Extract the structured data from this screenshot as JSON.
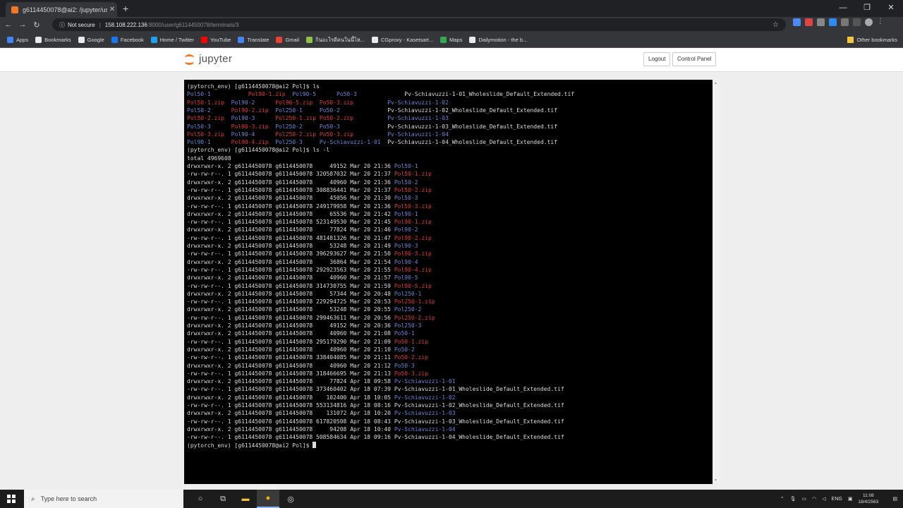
{
  "browser": {
    "tab_title": "g6114450078@ai2: /jupyter/user",
    "address_prefix": "Not secure",
    "address_host": "158.108.222.136",
    "address_path": ":8000/user/g6114450078/terminals/3",
    "window_controls": [
      "—",
      "❐",
      "✕"
    ]
  },
  "bookmarks": [
    {
      "label": "Apps",
      "color": "#4285f4"
    },
    {
      "label": "Bookmarks",
      "color": "#e8eaed"
    },
    {
      "label": "Google",
      "color": "#e8eaed"
    },
    {
      "label": "Facebook",
      "color": "#1877f2"
    },
    {
      "label": "Home / Twitter",
      "color": "#1da1f2"
    },
    {
      "label": "YouTube",
      "color": "#ff0000"
    },
    {
      "label": "Translate",
      "color": "#4285f4"
    },
    {
      "label": "Gmail",
      "color": "#ea4335"
    },
    {
      "label": "กินอะไรดีคนในนี้ไห...",
      "color": "#8bc34a"
    },
    {
      "label": "CGproxy - Kasetsart...",
      "color": "#e8eaed"
    },
    {
      "label": "Maps",
      "color": "#34a853"
    },
    {
      "label": "Dailymotion - the b...",
      "color": "#e8eaed"
    }
  ],
  "bookmarks_other": "Other bookmarks",
  "jupyter": {
    "logo_text": "jupyter",
    "logout_label": "Logout",
    "control_panel_label": "Control Panel"
  },
  "terminal": {
    "lines": [
      {
        "spans": [
          {
            "t": "(pytorch_env) [g6114450078@ai2 Pol]$ ls",
            "c": "white"
          }
        ]
      },
      {
        "spans": [
          {
            "t": "Pol50-1           ",
            "c": "blue"
          },
          {
            "t": "Pol90-1.zip  ",
            "c": "red"
          },
          {
            "t": "Pol90-5      ",
            "c": "blue"
          },
          {
            "t": "Po50-3              ",
            "c": "blue"
          },
          {
            "t": "Pv-Schiavuzzi-1-01_Wholeslide_Default_Extended.tif",
            "c": "white"
          }
        ]
      },
      {
        "spans": [
          {
            "t": "Pol50-1.zip  ",
            "c": "red"
          },
          {
            "t": "Pol90-2      ",
            "c": "blue"
          },
          {
            "t": "Pol90-5.zip  ",
            "c": "red"
          },
          {
            "t": "Po50-3.zip          ",
            "c": "red"
          },
          {
            "t": "Pv-Schiavuzzi-1-02",
            "c": "blue"
          }
        ]
      },
      {
        "spans": [
          {
            "t": "Pol50-2      ",
            "c": "blue"
          },
          {
            "t": "Pol90-2.zip  ",
            "c": "red"
          },
          {
            "t": "Pol250-1     ",
            "c": "blue"
          },
          {
            "t": "Po50-2              ",
            "c": "blue"
          },
          {
            "t": "Pv-Schiavuzzi-1-02_Wholeslide_Default_Extended.tif",
            "c": "white"
          }
        ]
      },
      {
        "spans": [
          {
            "t": "Pol50-2.zip  ",
            "c": "red"
          },
          {
            "t": "Pol90-3      ",
            "c": "blue"
          },
          {
            "t": "Pol250-1.zip ",
            "c": "red"
          },
          {
            "t": "Po50-2.zip          ",
            "c": "red"
          },
          {
            "t": "Pv-Schiavuzzi-1-03",
            "c": "blue"
          }
        ]
      },
      {
        "spans": [
          {
            "t": "Pol50-3      ",
            "c": "blue"
          },
          {
            "t": "Pol90-3.zip  ",
            "c": "red"
          },
          {
            "t": "Pol250-2     ",
            "c": "blue"
          },
          {
            "t": "Po50-3              ",
            "c": "blue"
          },
          {
            "t": "Pv-Schiavuzzi-1-03_Wholeslide_Default_Extended.tif",
            "c": "white"
          }
        ]
      },
      {
        "spans": [
          {
            "t": "Pol50-3.zip  ",
            "c": "red"
          },
          {
            "t": "Pol90-4      ",
            "c": "blue"
          },
          {
            "t": "Pol250-2.zip ",
            "c": "red"
          },
          {
            "t": "Po50-3.zip          ",
            "c": "red"
          },
          {
            "t": "Pv-Schiavuzzi-1-04",
            "c": "blue"
          }
        ]
      },
      {
        "spans": [
          {
            "t": "Pol90-1      ",
            "c": "blue"
          },
          {
            "t": "Pol90-4.zip  ",
            "c": "red"
          },
          {
            "t": "Pol250-3     ",
            "c": "blue"
          },
          {
            "t": "Pv-Schiavuzzi-1-01  ",
            "c": "blue"
          },
          {
            "t": "Pv-Schiavuzzi-1-04_Wholeslide_Default_Extended.tif",
            "c": "white"
          }
        ]
      },
      {
        "spans": [
          {
            "t": "(pytorch_env) [g6114450078@ai2 Pol]$ ls -l",
            "c": "white"
          }
        ]
      },
      {
        "spans": [
          {
            "t": "total 4969608",
            "c": "white"
          }
        ]
      },
      {
        "spans": [
          {
            "t": "drwxrwxr-x. 2 g6114450078 g6114450078     49152 Mar 20 21:36 ",
            "c": "white"
          },
          {
            "t": "Pol50-1",
            "c": "blue"
          }
        ]
      },
      {
        "spans": [
          {
            "t": "-rw-rw-r--. 1 g6114450078 g6114450078 320587032 Mar 20 21:37 ",
            "c": "white"
          },
          {
            "t": "Pol50-1.zip",
            "c": "red"
          }
        ]
      },
      {
        "spans": [
          {
            "t": "drwxrwxr-x. 2 g6114450078 g6114450078     40960 Mar 20 21:36 ",
            "c": "white"
          },
          {
            "t": "Pol50-2",
            "c": "blue"
          }
        ]
      },
      {
        "spans": [
          {
            "t": "-rw-rw-r--. 1 g6114450078 g6114450078 308836441 Mar 20 21:37 ",
            "c": "white"
          },
          {
            "t": "Pol50-2.zip",
            "c": "red"
          }
        ]
      },
      {
        "spans": [
          {
            "t": "drwxrwxr-x. 2 g6114450078 g6114450078     45056 Mar 20 21:30 ",
            "c": "white"
          },
          {
            "t": "Pol50-3",
            "c": "blue"
          }
        ]
      },
      {
        "spans": [
          {
            "t": "-rw-rw-r--. 1 g6114450078 g6114450078 249179958 Mar 20 21:36 ",
            "c": "white"
          },
          {
            "t": "Pol50-3.zip",
            "c": "red"
          }
        ]
      },
      {
        "spans": [
          {
            "t": "drwxrwxr-x. 2 g6114450078 g6114450078     65536 Mar 20 21:42 ",
            "c": "white"
          },
          {
            "t": "Pol90-1",
            "c": "blue"
          }
        ]
      },
      {
        "spans": [
          {
            "t": "-rw-rw-r--. 1 g6114450078 g6114450078 523149530 Mar 20 21:45 ",
            "c": "white"
          },
          {
            "t": "Pol90-1.zip",
            "c": "red"
          }
        ]
      },
      {
        "spans": [
          {
            "t": "drwxrwxr-x. 2 g6114450078 g6114450078     77824 Mar 20 21:46 ",
            "c": "white"
          },
          {
            "t": "Pol90-2",
            "c": "blue"
          }
        ]
      },
      {
        "spans": [
          {
            "t": "-rw-rw-r--. 1 g6114450078 g6114450078 481481326 Mar 20 21:47 ",
            "c": "white"
          },
          {
            "t": "Pol90-2.zip",
            "c": "red"
          }
        ]
      },
      {
        "spans": [
          {
            "t": "drwxrwxr-x. 2 g6114450078 g6114450078     53248 Mar 20 21:49 ",
            "c": "white"
          },
          {
            "t": "Pol90-3",
            "c": "blue"
          }
        ]
      },
      {
        "spans": [
          {
            "t": "-rw-rw-r--. 1 g6114450078 g6114450078 396293627 Mar 20 21:50 ",
            "c": "white"
          },
          {
            "t": "Pol90-3.zip",
            "c": "red"
          }
        ]
      },
      {
        "spans": [
          {
            "t": "drwxrwxr-x. 2 g6114450078 g6114450078     36864 Mar 20 21:54 ",
            "c": "white"
          },
          {
            "t": "Pol90-4",
            "c": "blue"
          }
        ]
      },
      {
        "spans": [
          {
            "t": "-rw-rw-r--. 1 g6114450078 g6114450078 292923563 Mar 20 21:55 ",
            "c": "white"
          },
          {
            "t": "Pol90-4.zip",
            "c": "red"
          }
        ]
      },
      {
        "spans": [
          {
            "t": "drwxrwxr-x. 2 g6114450078 g6114450078     40960 Mar 20 21:57 ",
            "c": "white"
          },
          {
            "t": "Pol90-5",
            "c": "blue"
          }
        ]
      },
      {
        "spans": [
          {
            "t": "-rw-rw-r--. 1 g6114450078 g6114450078 314730755 Mar 20 21:59 ",
            "c": "white"
          },
          {
            "t": "Pol90-5.zip",
            "c": "red"
          }
        ]
      },
      {
        "spans": [
          {
            "t": "drwxrwxr-x. 2 g6114450078 g6114450078     57344 Mar 20 20:48 ",
            "c": "white"
          },
          {
            "t": "Pol250-1",
            "c": "blue"
          }
        ]
      },
      {
        "spans": [
          {
            "t": "-rw-rw-r--. 1 g6114450078 g6114450078 229294725 Mar 20 20:53 ",
            "c": "white"
          },
          {
            "t": "Pol250-1.zip",
            "c": "red"
          }
        ]
      },
      {
        "spans": [
          {
            "t": "drwxrwxr-x. 2 g6114450078 g6114450078     53248 Mar 20 20:55 ",
            "c": "white"
          },
          {
            "t": "Pol250-2",
            "c": "blue"
          }
        ]
      },
      {
        "spans": [
          {
            "t": "-rw-rw-r--. 1 g6114450078 g6114450078 299463611 Mar 20 20:56 ",
            "c": "white"
          },
          {
            "t": "Pol250-2.zip",
            "c": "red"
          }
        ]
      },
      {
        "spans": [
          {
            "t": "drwxrwxr-x. 2 g6114450078 g6114450078     49152 Mar 20 20:36 ",
            "c": "white"
          },
          {
            "t": "Pol250-3",
            "c": "blue"
          }
        ]
      },
      {
        "spans": [
          {
            "t": "drwxrwxr-x. 2 g6114450078 g6114450078     40960 Mar 20 21:08 ",
            "c": "white"
          },
          {
            "t": "Po50-1",
            "c": "blue"
          }
        ]
      },
      {
        "spans": [
          {
            "t": "-rw-rw-r--. 1 g6114450078 g6114450078 295179290 Mar 20 21:09 ",
            "c": "white"
          },
          {
            "t": "Po50-1.zip",
            "c": "red"
          }
        ]
      },
      {
        "spans": [
          {
            "t": "drwxrwxr-x. 2 g6114450078 g6114450078     40960 Mar 20 21:10 ",
            "c": "white"
          },
          {
            "t": "Po50-2",
            "c": "blue"
          }
        ]
      },
      {
        "spans": [
          {
            "t": "-rw-rw-r--. 1 g6114450078 g6114450078 338404085 Mar 20 21:11 ",
            "c": "white"
          },
          {
            "t": "Po50-2.zip",
            "c": "red"
          }
        ]
      },
      {
        "spans": [
          {
            "t": "drwxrwxr-x. 2 g6114450078 g6114450078     40960 Mar 20 21:12 ",
            "c": "white"
          },
          {
            "t": "Po50-3",
            "c": "blue"
          }
        ]
      },
      {
        "spans": [
          {
            "t": "-rw-rw-r--. 1 g6114450078 g6114450078 318466695 Mar 20 21:13 ",
            "c": "white"
          },
          {
            "t": "Po50-3.zip",
            "c": "red"
          }
        ]
      },
      {
        "spans": [
          {
            "t": "drwxrwxr-x. 2 g6114450078 g6114450078     77824 Apr 18 09:58 ",
            "c": "white"
          },
          {
            "t": "Pv-Schiavuzzi-1-01",
            "c": "blue"
          }
        ]
      },
      {
        "spans": [
          {
            "t": "-rw-rw-r--. 1 g6114450078 g6114450078 373460402 Apr 18 07:39 ",
            "c": "white"
          },
          {
            "t": "Pv-Schiavuzzi-1-01_Wholeslide_Default_Extended.tif",
            "c": "white"
          }
        ]
      },
      {
        "spans": [
          {
            "t": "drwxrwxr-x. 2 g6114450078 g6114450078    102400 Apr 18 10:05 ",
            "c": "white"
          },
          {
            "t": "Pv-Schiavuzzi-1-02",
            "c": "blue"
          }
        ]
      },
      {
        "spans": [
          {
            "t": "-rw-rw-r--. 1 g6114450078 g6114450078 553134816 Apr 18 08:16 ",
            "c": "white"
          },
          {
            "t": "Pv-Schiavuzzi-1-02_Wholeslide_Default_Extended.tif",
            "c": "white"
          }
        ]
      },
      {
        "spans": [
          {
            "t": "drwxrwxr-x. 2 g6114450078 g6114450078    131072 Apr 18 10:20 ",
            "c": "white"
          },
          {
            "t": "Pv-Schiavuzzi-1-03",
            "c": "blue"
          }
        ]
      },
      {
        "spans": [
          {
            "t": "-rw-rw-r--. 1 g6114450078 g6114450078 617820508 Apr 18 08:43 ",
            "c": "white"
          },
          {
            "t": "Pv-Schiavuzzi-1-03_Wholeslide_Default_Extended.tif",
            "c": "white"
          }
        ]
      },
      {
        "spans": [
          {
            "t": "drwxrwxr-x. 2 g6114450078 g6114450078     94208 Apr 18 10:40 ",
            "c": "white"
          },
          {
            "t": "Pv-Schiavuzzi-1-04",
            "c": "blue"
          }
        ]
      },
      {
        "spans": [
          {
            "t": "-rw-rw-r--. 1 g6114450078 g6114450078 508584634 Apr 18 09:16 ",
            "c": "white"
          },
          {
            "t": "Pv-Schiavuzzi-1-04_Wholeslide_Default_Extended.tif",
            "c": "white"
          }
        ]
      },
      {
        "spans": [
          {
            "t": "(pytorch_env) [g6114450078@ai2 Pol]$ ",
            "c": "white"
          }
        ],
        "cursor": true
      }
    ]
  },
  "taskbar": {
    "search_placeholder": "Type here to search",
    "language": "ENG",
    "time": "11:08",
    "date": "18/4/2563"
  }
}
